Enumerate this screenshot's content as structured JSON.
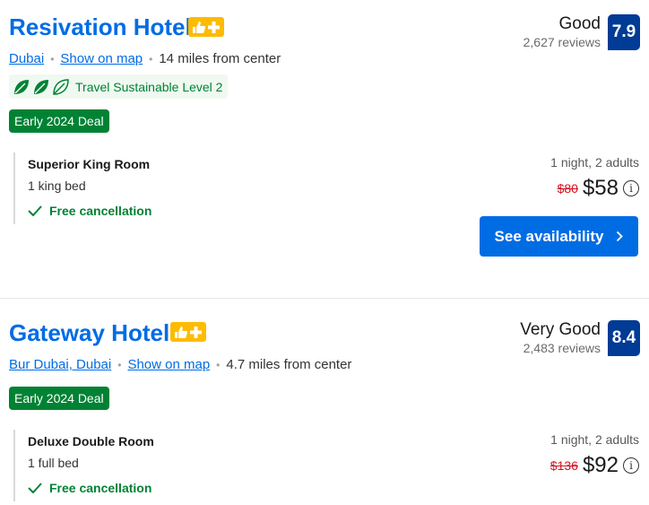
{
  "hotels": [
    {
      "name": "Resivation Hotel",
      "location": "Dubai",
      "map_link": "Show on map",
      "distance": "14 miles from center",
      "sustainability": "Travel Sustainable Level 2",
      "deal": "Early 2024 Deal",
      "score_word": "Good",
      "reviews": "2,627 reviews",
      "score": "7.9",
      "room": {
        "name": "Superior King Room",
        "bed": "1 king bed",
        "cancellation": "Free cancellation"
      },
      "stay": "1 night, 2 adults",
      "old_price": "$80",
      "price": "$58",
      "cta": "See availability"
    },
    {
      "name": "Gateway Hotel",
      "location": "Bur Dubai, Dubai",
      "map_link": "Show on map",
      "distance": "4.7 miles from center",
      "deal": "Early 2024 Deal",
      "score_word": "Very Good",
      "reviews": "2,483 reviews",
      "score": "8.4",
      "room": {
        "name": "Deluxe Double Room",
        "bed": "1 full bed",
        "cancellation": "Free cancellation"
      },
      "stay": "1 night, 2 adults",
      "old_price": "$136",
      "price": "$92"
    }
  ],
  "colors": {
    "link": "#006ce4",
    "score_box": "#003b95",
    "deal_badge": "#008234",
    "strike_price": "#d4111e",
    "ad_badge": "#febb02"
  },
  "icons": {
    "ad_badge": [
      "thumbs-up-icon",
      "plus-icon"
    ],
    "sustainability": "leaf-icon",
    "cancellation": "checkmark-icon",
    "price_info": "info-icon",
    "button": "chevron-right-icon"
  }
}
